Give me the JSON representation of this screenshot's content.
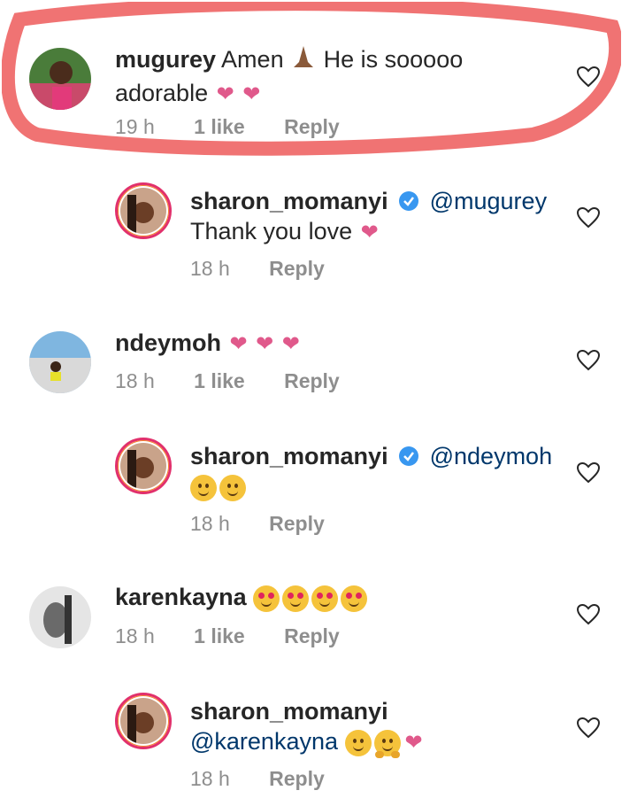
{
  "comments": [
    {
      "username": "mugurey",
      "text": "Amen",
      "text2": "He is sooooo",
      "text3": "adorable",
      "time": "19 h",
      "likes": "1 like",
      "reply": "Reply"
    },
    {
      "username": "sharon_momanyi",
      "mention": "@mugurey",
      "text": "Thank you love",
      "time": "18 h",
      "reply": "Reply"
    },
    {
      "username": "ndeymoh",
      "time": "18 h",
      "likes": "1 like",
      "reply": "Reply"
    },
    {
      "username": "sharon_momanyi",
      "mention": "@ndeymoh",
      "time": "18 h",
      "reply": "Reply"
    },
    {
      "username": "karenkayna",
      "time": "18 h",
      "likes": "1 like",
      "reply": "Reply"
    },
    {
      "username": "sharon_momanyi",
      "mention": "@karenkayna",
      "time": "18 h",
      "reply": "Reply"
    }
  ],
  "icons": {
    "heart_emoji": "❤",
    "like": "heart-outline-icon",
    "verified": "verified-badge-icon"
  },
  "colors": {
    "highlight": "#f07373",
    "heart": "#e0598b",
    "mention": "#00376b",
    "meta": "#8e8e8e"
  }
}
